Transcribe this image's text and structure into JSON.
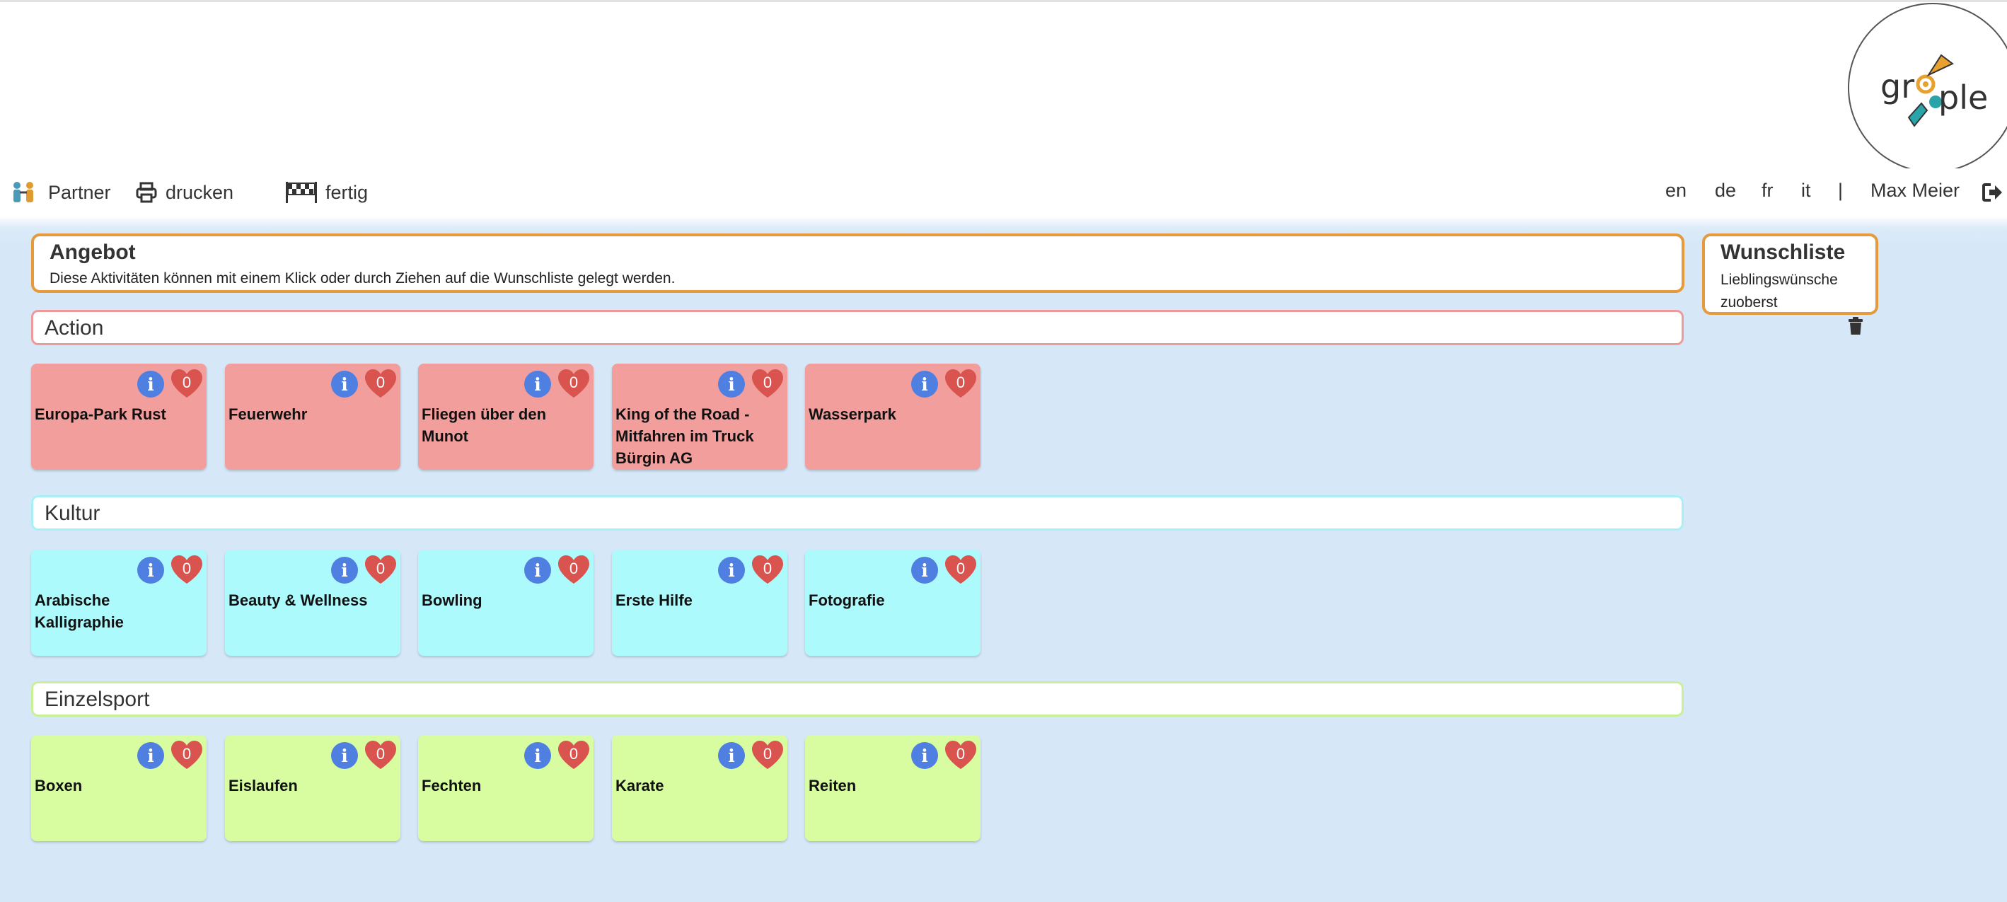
{
  "nav": {
    "partner_label": "Partner",
    "print_label": "drucken",
    "done_label": "fertig",
    "languages": [
      "en",
      "de",
      "fr",
      "it"
    ],
    "separator": "|",
    "user_name": "Max Meier"
  },
  "offer": {
    "title": "Angebot",
    "description": "Diese Aktivitäten können mit einem Klick oder durch Ziehen auf die Wunschliste gelegt werden."
  },
  "wishlist": {
    "title": "Wunschliste",
    "subtitle_line1": "Lieblingswünsche",
    "subtitle_line2": "zuoberst"
  },
  "categories": [
    {
      "name": "Action",
      "color": "#f19e9c",
      "border": "#ef9a9a",
      "activities": [
        {
          "name": "Europa-Park Rust",
          "likes": "0"
        },
        {
          "name": "Feuerwehr",
          "likes": "0"
        },
        {
          "name": "Fliegen über den Munot",
          "likes": "0"
        },
        {
          "name": "King of the Road - Mitfahren im Truck Bürgin AG",
          "likes": "0"
        },
        {
          "name": "Wasserpark",
          "likes": "0"
        }
      ]
    },
    {
      "name": "Kultur",
      "color": "#adfafd",
      "border": "#a8f0f6",
      "activities": [
        {
          "name": "Arabische Kalligraphie",
          "likes": "0"
        },
        {
          "name": "Beauty & Wellness",
          "likes": "0"
        },
        {
          "name": "Bowling",
          "likes": "0"
        },
        {
          "name": "Erste Hilfe",
          "likes": "0"
        },
        {
          "name": "Fotografie",
          "likes": "0"
        }
      ]
    },
    {
      "name": "Einzelsport",
      "color": "#d7fda0",
      "border": "#c9f094",
      "activities": [
        {
          "name": "Boxen",
          "likes": "0"
        },
        {
          "name": "Eislaufen",
          "likes": "0"
        },
        {
          "name": "Fechten",
          "likes": "0"
        },
        {
          "name": "Karate",
          "likes": "0"
        },
        {
          "name": "Reiten",
          "likes": "0"
        }
      ]
    }
  ],
  "colors": {
    "accent_orange": "#e79a3b",
    "info_blue": "#4f7fe0",
    "heart_red": "#d9534f",
    "background": "#d6e8f8"
  },
  "icons": {
    "partner": "people-icon",
    "print": "printer-icon",
    "done": "checkered-flag-icon",
    "logout": "sign-out-icon",
    "trash": "trash-icon",
    "info": "info-icon",
    "like": "heart-icon"
  },
  "logo": {
    "text_left": "gr",
    "text_right": "ple"
  }
}
